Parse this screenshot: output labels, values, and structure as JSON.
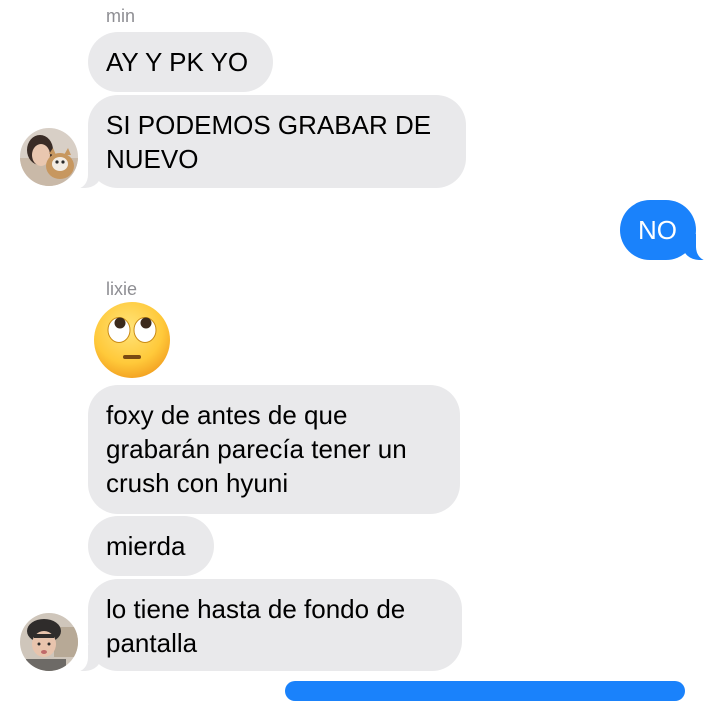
{
  "conversation": {
    "group1": {
      "sender": "min",
      "messages": [
        {
          "text": "AY Y PK YO"
        },
        {
          "text": "SI PODEMOS GRABAR DE NUEVO"
        }
      ]
    },
    "outgoing": {
      "text": "NO"
    },
    "group2": {
      "sender": "lixie",
      "emoji": "face-with-rolling-eyes",
      "messages": [
        {
          "text": "foxy de antes de que grabarán parecía tener un crush con hyuni"
        },
        {
          "text": "mierda"
        },
        {
          "text": "lo tiene hasta de fondo de pantalla"
        }
      ]
    }
  },
  "colors": {
    "incoming_bubble": "#e9e9eb",
    "outgoing_bubble": "#1a82fb",
    "sender_label": "#8e8e93"
  }
}
